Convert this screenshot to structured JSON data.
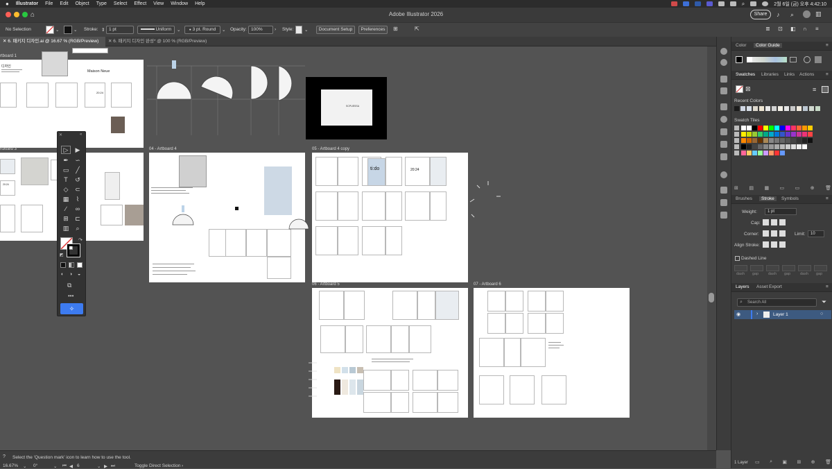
{
  "menubar": {
    "app": "Illustrator",
    "items": [
      "File",
      "Edit",
      "Object",
      "Type",
      "Select",
      "Effect",
      "View",
      "Window",
      "Help"
    ],
    "clock": "2월 6일 (금) 오후 4:42:10"
  },
  "window": {
    "title": "Adobe Illustrator 2026",
    "share_label": "Share"
  },
  "control_bar": {
    "selection": "No Selection",
    "stroke_label": "Stroke:",
    "stroke_value": "1 pt",
    "profile": "Uniform",
    "brush": "3 pt. Round",
    "opacity_label": "Opacity:",
    "opacity_value": "100%",
    "style_label": "Style:",
    "document_setup": "Document Setup",
    "preferences": "Preferences"
  },
  "tabs": [
    {
      "label": "6. 패키지 디자인.ai @ 16.67 % (RGB/Preview)",
      "active": true
    },
    {
      "label": "6. 패키지 디자인 완성* @ 100 % (RGB/Preview)",
      "active": false
    }
  ],
  "artboards": {
    "ab1": "rtboard 1",
    "ab3": "rtboard 3",
    "ab4": "04 - Artboard 4",
    "ab4copy": "05 - Artboard 4 copy",
    "ab5": "06 - Artboard 5",
    "ab6": "07 - Artboard 6",
    "ab1_heading": "디자인",
    "ab1_font": "Maison Neue",
    "logo_text": "20:24",
    "logo_text_alt": "ti:do",
    "box_brand": "SCPUESSA"
  },
  "panels": {
    "color_tabs": [
      "Color",
      "Color Guide"
    ],
    "swatch_tabs": [
      "Swatches",
      "Libraries",
      "Links",
      "Actions"
    ],
    "recent_colors": "Recent Colors",
    "swatch_tiles": "Swatch Tiles",
    "stroke_tabs": [
      "Brushes",
      "Stroke",
      "Symbols"
    ],
    "weight_label": "Weight:",
    "weight_value": "1 pt",
    "cap_label": "Cap:",
    "corner_label": "Corner:",
    "limit_label": "Limit:",
    "limit_value": "10",
    "align_label": "Align Stroke:",
    "dashed_label": "Dashed Line",
    "dash_labels": [
      "dash",
      "gap",
      "dash",
      "gap",
      "dash",
      "gap"
    ],
    "layers_tabs": [
      "Layers",
      "Asset Export"
    ],
    "search_placeholder": "Search All",
    "layer_name": "Layer 1",
    "layer_count": "1 Layer"
  },
  "status_bar": {
    "hint": "Select the 'Question mark' icon to learn how to use the tool.",
    "zoom": "16.67%",
    "rotation": "0°",
    "artboard_num": "6",
    "tool_name": "Toggle Direct Selection"
  },
  "colors": {
    "accent": "#3d7bf0",
    "selected_layer": "#3d5a80"
  },
  "icons": {
    "toolbar": [
      "selection-tool-icon",
      "direct-selection-tool-icon",
      "pen-tool-icon",
      "curvature-tool-icon",
      "rectangle-tool-icon",
      "paintbrush-tool-icon",
      "type-tool-icon",
      "rotate-tool-icon",
      "eraser-tool-icon",
      "width-tool-icon",
      "gradient-tool-icon",
      "shape-builder-tool-icon",
      "eyedropper-tool-icon",
      "blend-tool-icon",
      "artboard-tool-icon",
      "slice-tool-icon",
      "graph-tool-icon",
      "zoom-tool-icon"
    ]
  }
}
